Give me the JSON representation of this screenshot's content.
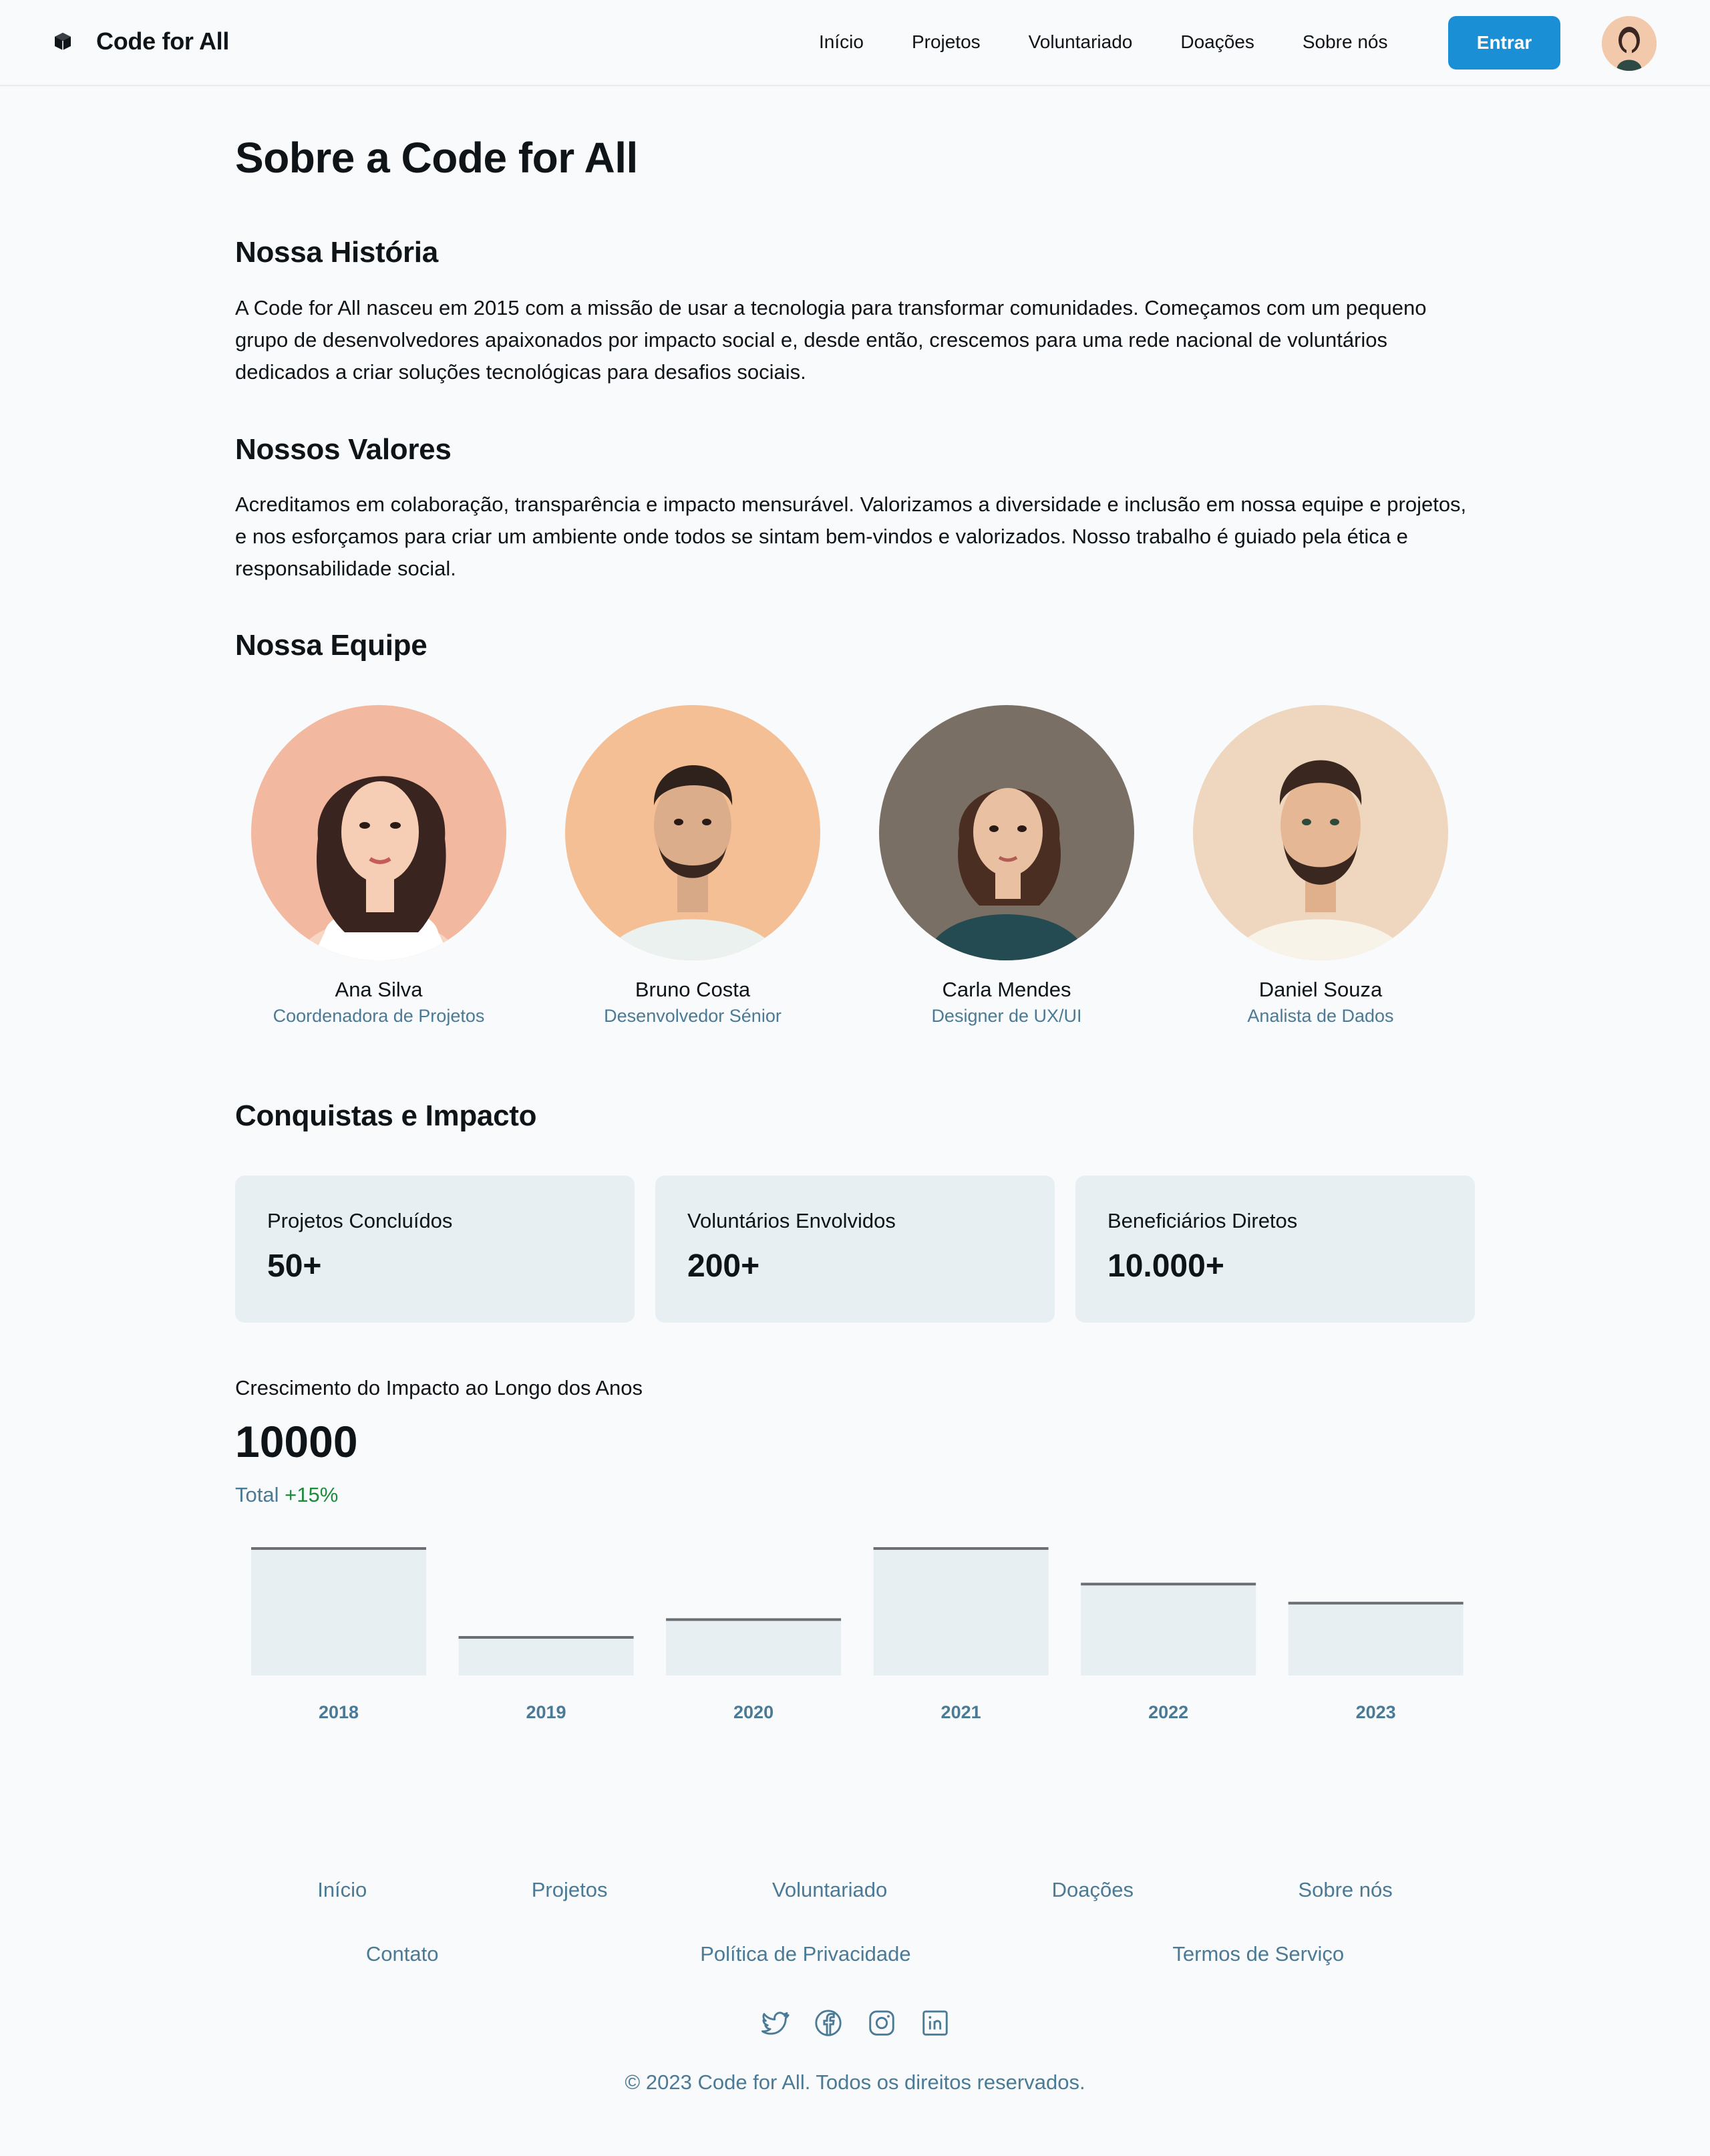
{
  "brand": {
    "name": "Code for All"
  },
  "nav": {
    "items": [
      "Início",
      "Projetos",
      "Voluntariado",
      "Doações",
      "Sobre nós"
    ],
    "login_label": "Entrar"
  },
  "page": {
    "title": "Sobre a Code for All",
    "history": {
      "heading": "Nossa História",
      "text": "A Code for All nasceu em 2015 com a missão de usar a tecnologia para transformar comunidades. Começamos com um pequeno grupo de desenvolvedores apaixonados por impacto social e, desde então, crescemos para uma rede nacional de voluntários dedicados a criar soluções tecnológicas para desafios sociais."
    },
    "values": {
      "heading": "Nossos Valores",
      "text": "Acreditamos em colaboração, transparência e impacto mensurável. Valorizamos a diversidade e inclusão em nossa equipe e projetos, e nos esforçamos para criar um ambiente onde todos se sintam bem-vindos e valorizados. Nosso trabalho é guiado pela ética e responsabilidade social."
    },
    "team": {
      "heading": "Nossa Equipe",
      "members": [
        {
          "name": "Ana Silva",
          "role": "Coordenadora de Projetos"
        },
        {
          "name": "Bruno Costa",
          "role": "Desenvolvedor Sénior"
        },
        {
          "name": "Carla Mendes",
          "role": "Designer de UX/UI"
        },
        {
          "name": "Daniel Souza",
          "role": "Analista de Dados"
        }
      ]
    },
    "impact": {
      "heading": "Conquistas e Impacto",
      "stats": [
        {
          "label": "Projetos Concluídos",
          "value": "50+"
        },
        {
          "label": "Voluntários Envolvidos",
          "value": "200+"
        },
        {
          "label": "Beneficiários Diretos",
          "value": "10.000+"
        }
      ]
    },
    "growth": {
      "title": "Crescimento do Impacto ao Longo dos Anos",
      "big_value": "10000",
      "sub_label": "Total",
      "sub_change": "+15%"
    }
  },
  "chart_data": {
    "type": "bar",
    "categories": [
      "2018",
      "2019",
      "2020",
      "2021",
      "2022",
      "2023"
    ],
    "values": [
      100,
      30,
      44,
      100,
      72,
      57
    ],
    "ylim": [
      0,
      100
    ],
    "bar_color": "#e8eff3",
    "top_line_color": "#6b6f73"
  },
  "footer": {
    "row1": [
      "Início",
      "Projetos",
      "Voluntariado",
      "Doações",
      "Sobre nós"
    ],
    "row2": [
      "Contato",
      "Política de Privacidade",
      "Termos de Serviço"
    ],
    "social": [
      "twitter-icon",
      "facebook-icon",
      "instagram-icon",
      "linkedin-icon"
    ],
    "copyright": "© 2023 Code for All. Todos os direitos reservados."
  },
  "colors": {
    "primary": "#1b8fd6",
    "muted": "#4a7a95",
    "positive": "#1f8a3b",
    "card": "#e8eff3"
  }
}
